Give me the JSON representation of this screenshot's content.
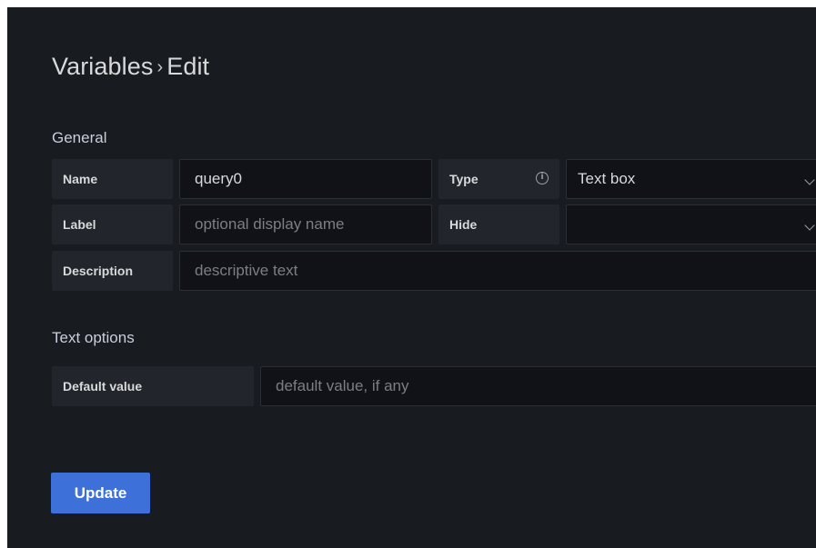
{
  "header": {
    "breadcrumb_parent": "Variables",
    "breadcrumb_separator": "›",
    "breadcrumb_current": "Edit"
  },
  "general": {
    "section_title": "General",
    "name_label": "Name",
    "name_value": "query0",
    "type_label": "Type",
    "type_value": "Text box",
    "label_label": "Label",
    "label_placeholder": "optional display name",
    "hide_label": "Hide",
    "hide_value": "",
    "description_label": "Description",
    "description_placeholder": "descriptive text"
  },
  "text_options": {
    "section_title": "Text options",
    "default_value_label": "Default value",
    "default_value_placeholder": "default value, if any"
  },
  "actions": {
    "update_label": "Update"
  },
  "icons": {
    "type_info": "info-icon",
    "type_dropdown": "chevron-down-icon",
    "hide_dropdown": "chevron-down-icon"
  },
  "colors": {
    "background": "#181b1f",
    "label_bg": "#22252b",
    "input_bg": "#111217",
    "primary_button": "#3d71d9"
  }
}
